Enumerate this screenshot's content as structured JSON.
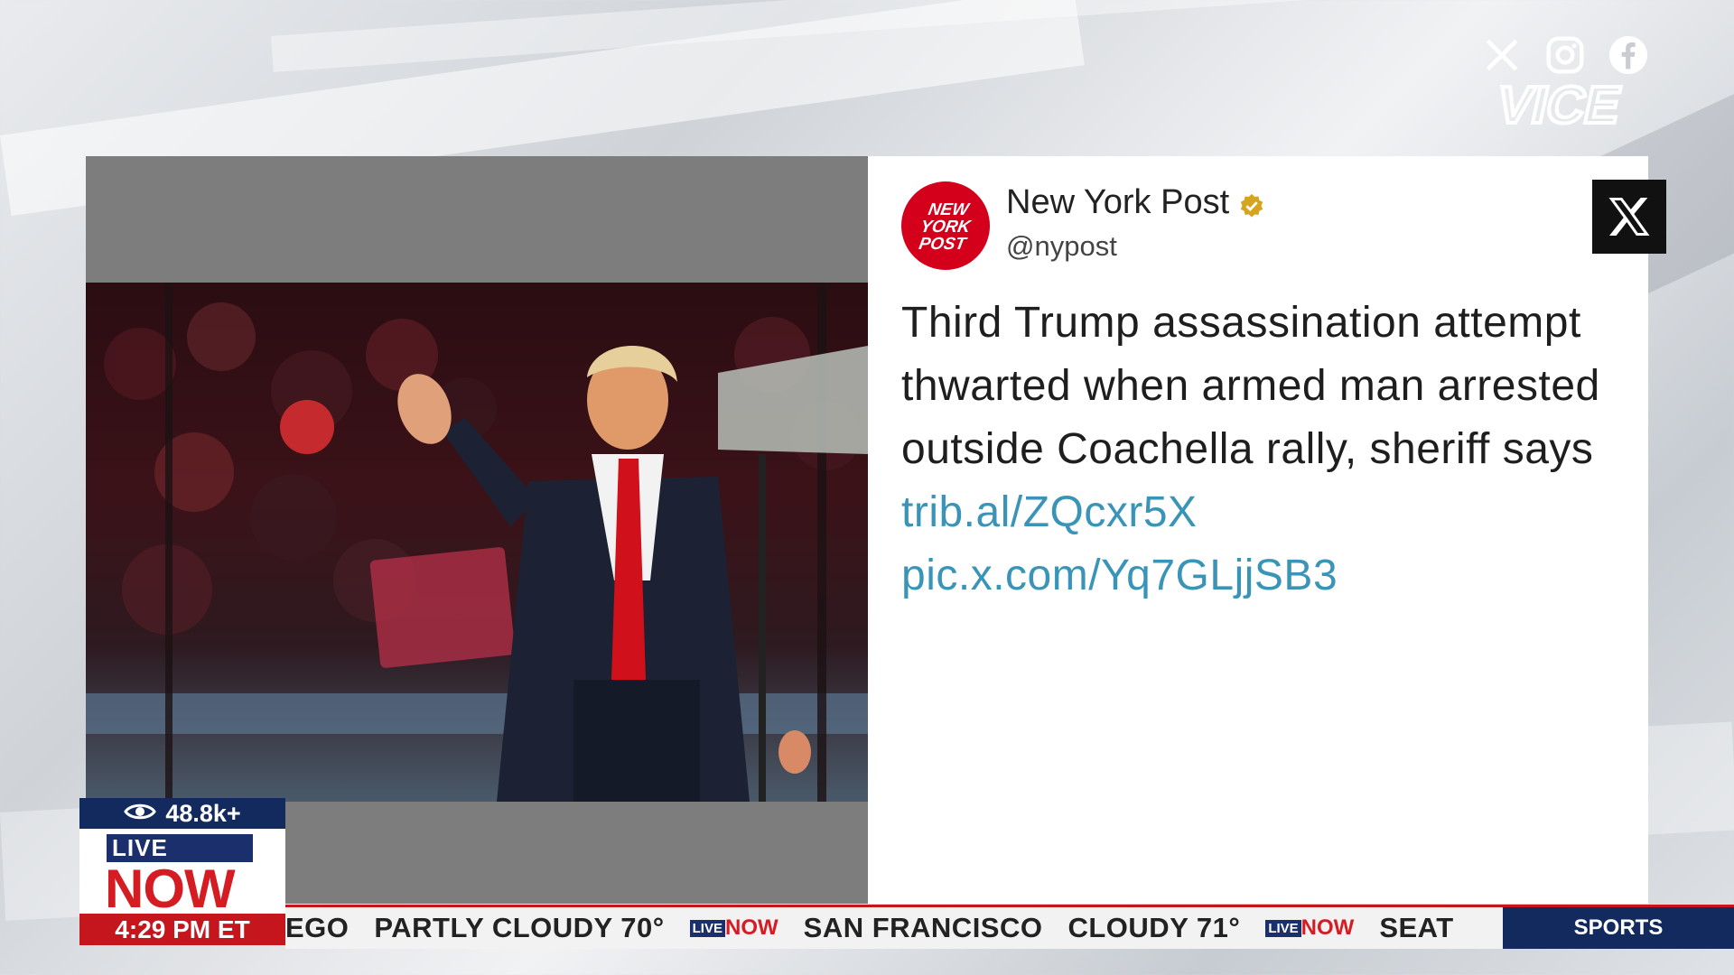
{
  "social": {
    "icons": [
      "x-icon",
      "instagram-icon",
      "facebook-icon"
    ]
  },
  "brand": {
    "name": "VICE"
  },
  "tweet": {
    "account_name": "New York Post",
    "handle": "@nypost",
    "avatar_text": [
      "NEW",
      "YORK",
      "POST"
    ],
    "verified": true,
    "text": "Third Trump assassination attempt thwarted when armed man arrested outside Coachella rally, sheriff says",
    "link1": "trib.al/ZQcxr5X",
    "link2": "pic.x.com/Yq7GLjjSB3",
    "platform_badge": "X"
  },
  "live_bug": {
    "viewers": "48.8k+",
    "live": "LIVE",
    "now": "NOW",
    "time": "4:29 PM ET"
  },
  "ticker": {
    "items": [
      "EGO",
      "PARTLY CLOUDY 70°",
      "SAN FRANCISCO",
      "CLOUDY 71°",
      "SEAT"
    ],
    "mini_logo_live": "LIVE",
    "mini_logo_now": "NOW",
    "section": "SPORTS"
  },
  "colors": {
    "accent_red": "#c4161c",
    "navy": "#132a5e",
    "link": "#3a94b8"
  }
}
